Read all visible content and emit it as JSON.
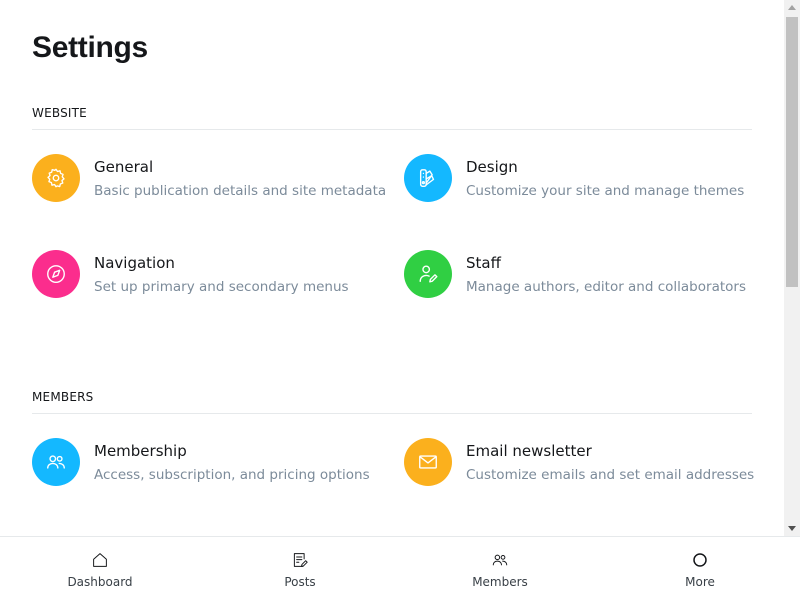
{
  "page": {
    "title": "Settings"
  },
  "colors": {
    "orange": "#fbb01d",
    "blue": "#14b8ff",
    "pink": "#fb2d8d",
    "green": "#30cf43"
  },
  "website": {
    "header": "Website",
    "items": [
      {
        "title": "General",
        "desc": "Basic publication details and site metadata",
        "icon": "gear-icon",
        "color": "#fbb01d"
      },
      {
        "title": "Design",
        "desc": "Customize your site and manage themes",
        "icon": "palette-icon",
        "color": "#14b8ff"
      },
      {
        "title": "Navigation",
        "desc": "Set up primary and secondary menus",
        "icon": "compass-icon",
        "color": "#fb2d8d"
      },
      {
        "title": "Staff",
        "desc": "Manage authors, editor and collaborators",
        "icon": "user-edit-icon",
        "color": "#30cf43"
      }
    ]
  },
  "members": {
    "header": "Members",
    "items": [
      {
        "title": "Membership",
        "desc": "Access, subscription, and pricing options",
        "icon": "members-icon",
        "color": "#14b8ff"
      },
      {
        "title": "Email newsletter",
        "desc": "Customize emails and set email addresses",
        "icon": "envelope-icon",
        "color": "#fbb01d"
      }
    ]
  },
  "bottom_nav": [
    {
      "label": "Dashboard",
      "icon": "home-icon"
    },
    {
      "label": "Posts",
      "icon": "posts-icon"
    },
    {
      "label": "Members",
      "icon": "members-icon"
    },
    {
      "label": "More",
      "icon": "circle-icon"
    }
  ]
}
